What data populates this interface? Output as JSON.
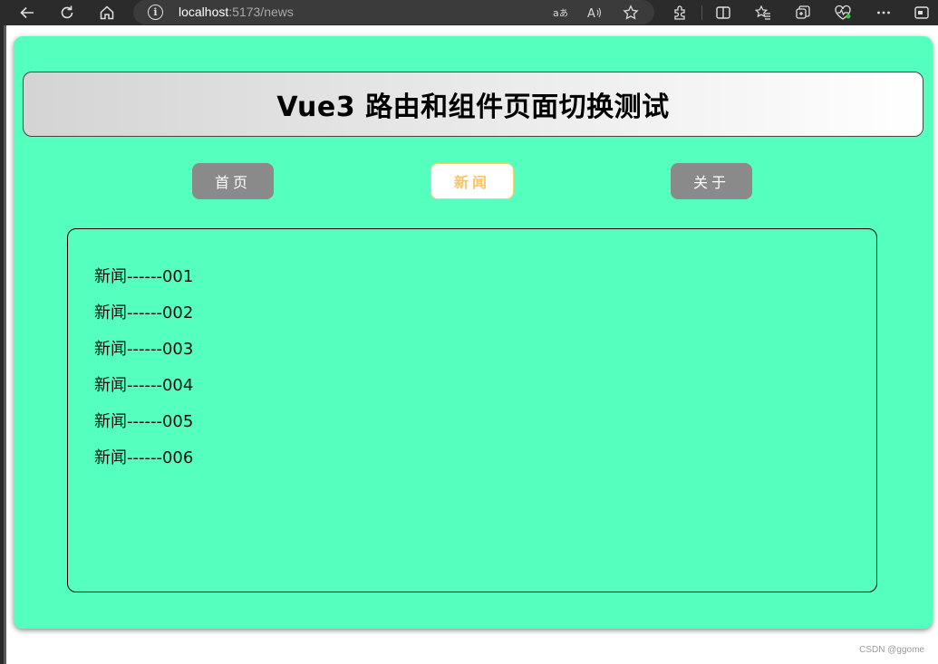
{
  "browser": {
    "url_host": "localhost",
    "url_rest": ":5173/news"
  },
  "app": {
    "title": "Vue3 路由和组件页面切换测试",
    "nav": [
      {
        "label": "首页",
        "active": false
      },
      {
        "label": "新闻",
        "active": true
      },
      {
        "label": "关于",
        "active": false
      }
    ],
    "news": [
      "新闻------001",
      "新闻------002",
      "新闻------003",
      "新闻------004",
      "新闻------005",
      "新闻------006"
    ]
  },
  "watermark": "CSDN @ggome",
  "colors": {
    "page_bg": "#55ffbe",
    "button_bg": "#8a8a8a",
    "active_text": "#ffc266"
  }
}
